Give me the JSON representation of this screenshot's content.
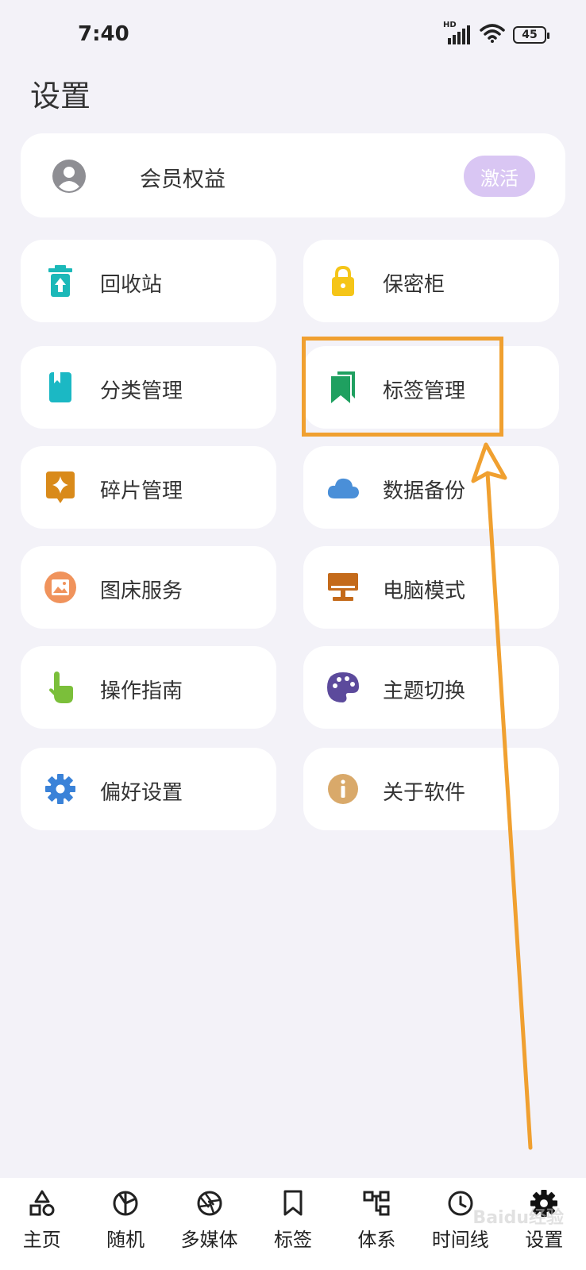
{
  "status_bar": {
    "time": "7:40",
    "network": "HD",
    "battery": "45"
  },
  "page": {
    "title": "设置"
  },
  "member": {
    "label": "会员权益",
    "action": "激活"
  },
  "grid": [
    {
      "label": "回收站",
      "icon": "recycle-bin-icon",
      "color": "#1bb8b8"
    },
    {
      "label": "保密柜",
      "icon": "lock-icon",
      "color": "#f5c518"
    },
    {
      "label": "分类管理",
      "icon": "book-icon",
      "color": "#1bb8c4"
    },
    {
      "label": "标签管理",
      "icon": "bookmark-icon",
      "color": "#1fa060"
    },
    {
      "label": "碎片管理",
      "icon": "sparkle-icon",
      "color": "#d98a1a"
    },
    {
      "label": "数据备份",
      "icon": "cloud-icon",
      "color": "#4a8fd8"
    },
    {
      "label": "图床服务",
      "icon": "image-icon",
      "color": "#f0935c"
    },
    {
      "label": "电脑模式",
      "icon": "desktop-icon",
      "color": "#c46a1a"
    },
    {
      "label": "操作指南",
      "icon": "touch-icon",
      "color": "#7bbf3a"
    },
    {
      "label": "主题切换",
      "icon": "palette-icon",
      "color": "#5c4a9c"
    },
    {
      "label": "偏好设置",
      "icon": "gear-icon",
      "color": "#3a82d8"
    },
    {
      "label": "关于软件",
      "icon": "info-icon",
      "color": "#d9a96a"
    }
  ],
  "bottom_nav": [
    {
      "label": "主页",
      "icon": "home-shapes-icon"
    },
    {
      "label": "随机",
      "icon": "random-icon"
    },
    {
      "label": "多媒体",
      "icon": "aperture-icon"
    },
    {
      "label": "标签",
      "icon": "bookmark-outline-icon"
    },
    {
      "label": "体系",
      "icon": "hierarchy-icon"
    },
    {
      "label": "时间线",
      "icon": "clock-icon"
    },
    {
      "label": "设置",
      "icon": "gear-icon"
    }
  ],
  "watermark": "Baidu经验",
  "colors": {
    "background": "#f3f2f8",
    "card": "#ffffff",
    "activate": "#d9c6f3",
    "highlight": "#f0a030"
  }
}
